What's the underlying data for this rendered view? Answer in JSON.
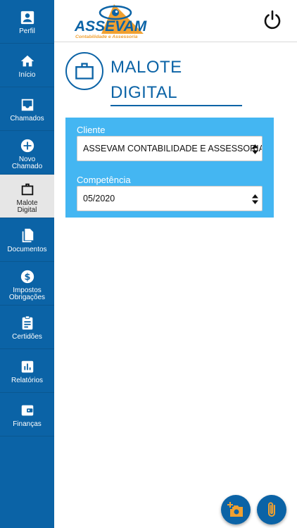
{
  "header": {
    "logo_text": "ASSEVAM",
    "logo_subtitle": "Contabilidade e Assessoria"
  },
  "sidebar": {
    "items": [
      {
        "label": "Perfil",
        "icon": "person-badge-icon"
      },
      {
        "label": "Início",
        "icon": "home-icon"
      },
      {
        "label": "Chamados",
        "icon": "inbox-icon"
      },
      {
        "label": "Novo Chamado",
        "icon": "plus-circle-icon"
      },
      {
        "label": "Malote Digital",
        "icon": "briefcase-icon",
        "active": true
      },
      {
        "label": "Documentos",
        "icon": "documents-icon"
      },
      {
        "label": "Impostos Obrigações",
        "icon": "dollar-circle-icon"
      },
      {
        "label": "Certidões",
        "icon": "clipboard-icon"
      },
      {
        "label": "Relatórios",
        "icon": "bar-chart-icon"
      },
      {
        "label": "Finanças",
        "icon": "wallet-icon"
      }
    ]
  },
  "page": {
    "title_line1": "MALOTE",
    "title_line2": "DIGITAL"
  },
  "filters": {
    "cliente_label": "Cliente",
    "cliente_value": "ASSEVAM CONTABILIDADE E ASSESSORIA E",
    "competencia_label": "Competência",
    "competencia_value": "05/2020"
  },
  "colors": {
    "primary": "#0b63a6",
    "panel": "#44b6f2",
    "logo_orange": "#f0a030"
  }
}
